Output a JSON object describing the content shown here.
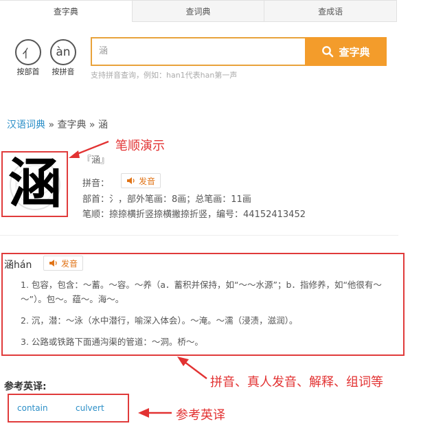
{
  "tabs": [
    {
      "label": "查字典"
    },
    {
      "label": "查词典"
    },
    {
      "label": "查成语"
    }
  ],
  "lookup": {
    "radical_icon": "亻",
    "radical_label": "按部首",
    "pinyin_icon": "àn",
    "pinyin_label": "按拼音"
  },
  "search": {
    "value": "涵",
    "button_label": "查字典",
    "hint": "支持拼音查询，例如：han1代表han第一声"
  },
  "breadcrumb": {
    "root": "汉语词典",
    "sep1": " » ",
    "section": "查字典",
    "sep2": " » ",
    "current": "涵"
  },
  "character": {
    "glyph": "涵",
    "title": "『涵』",
    "pinyin_label": "拼音：",
    "pron_button": "发音",
    "radical_line": "部首：氵，部外笔画：8画；总笔画：11画",
    "stroke_line": "笔顺：捺捺横折竖捺横撇捺折竖，编号：44152413452"
  },
  "definition": {
    "head": "涵hán",
    "pron_button": "发音",
    "items": [
      "1. 包容，包含：～蓄。～容。～养（a．蓄积并保持，如“～～水源”；b．指修养，如“他很有～～”）。包～。蕴～。海～。",
      "2. 沉，潜：～泳（水中潜行，喻深入体会）。～淹。～濡（浸渍，滋润）。",
      "3. 公路或铁路下面通沟渠的管道：～洞。桥～。"
    ]
  },
  "english": {
    "heading": "参考英译:",
    "words": [
      "contain",
      "culvert"
    ]
  },
  "annotations": {
    "stroke": "笔顺演示",
    "features": "拼音、真人发音、解释、组词等",
    "english": "参考英译"
  },
  "colors": {
    "accent": "#f39c2b",
    "annotation_red": "#e23232",
    "link": "#2a8ec7"
  }
}
